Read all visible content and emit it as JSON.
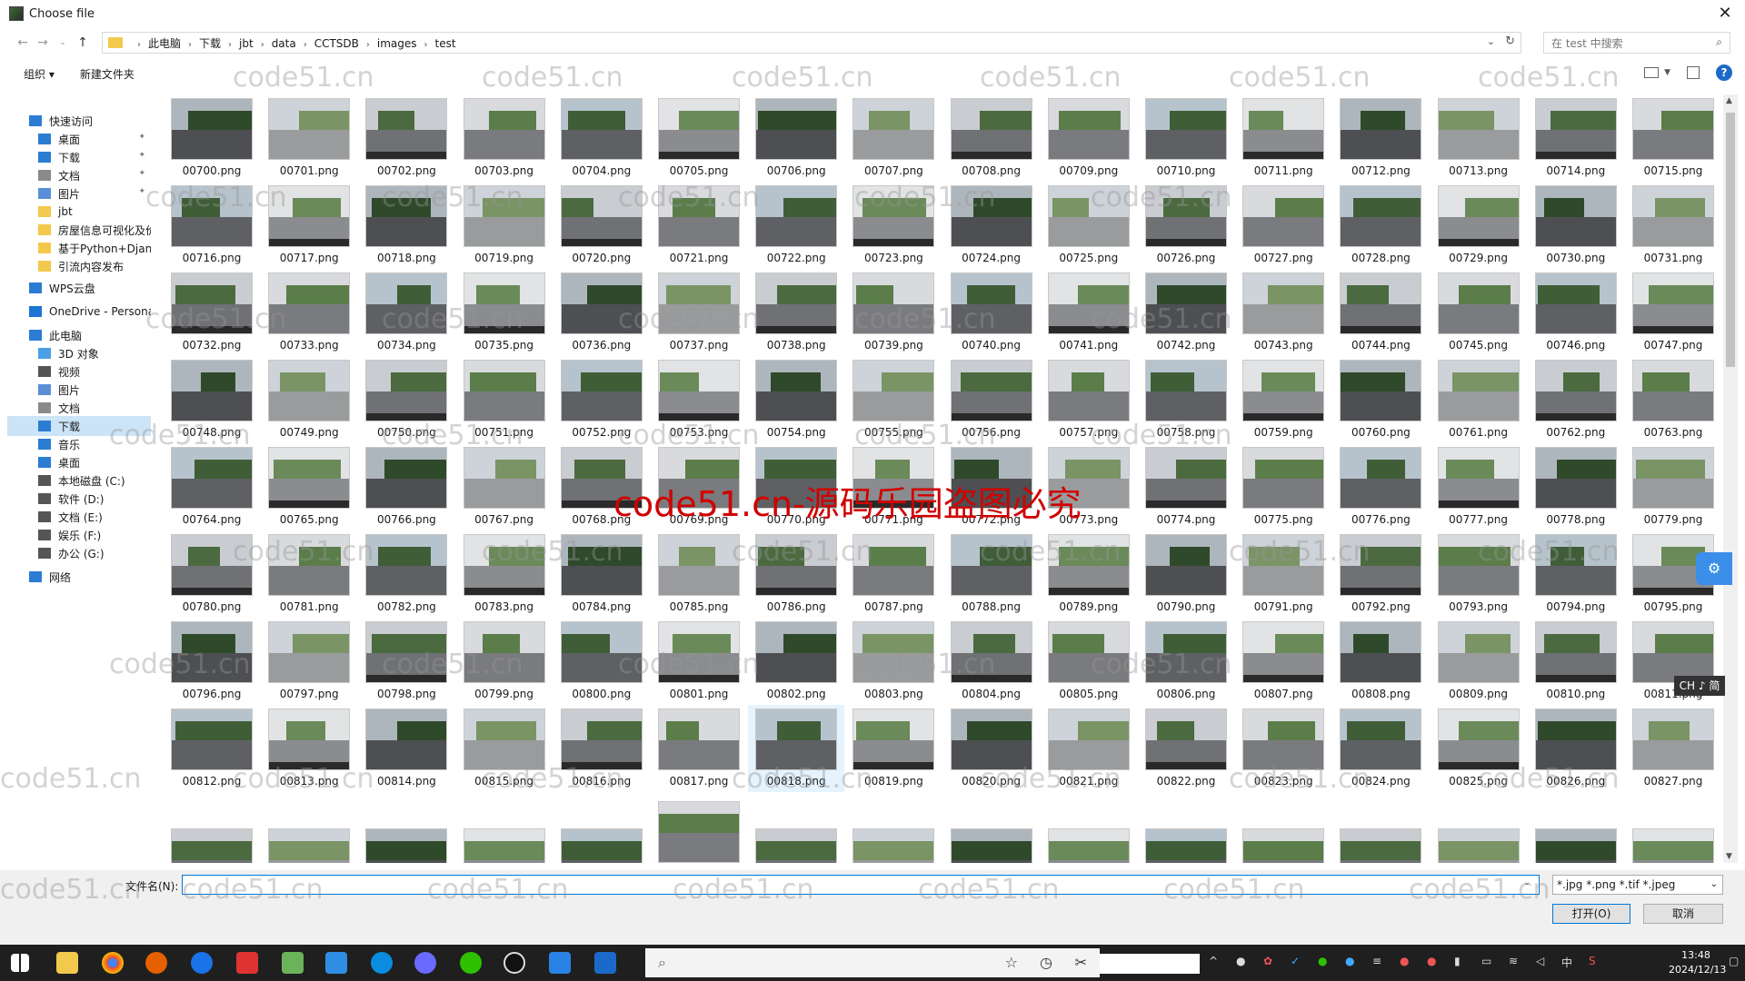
{
  "window": {
    "title": "Choose file",
    "close_glyph": "✕"
  },
  "address": {
    "crumbs": [
      "此电脑",
      "下载",
      "jbt",
      "data",
      "CCTSDB",
      "images",
      "test"
    ],
    "search_placeholder": "在 test 中搜索"
  },
  "toolbar": {
    "organize": "组织 ▾",
    "new_folder": "新建文件夹"
  },
  "nav": {
    "items": [
      {
        "label": "快速访问",
        "icon": "star-icon",
        "color": "#2b7cd3",
        "indent": 0,
        "pinned": false
      },
      {
        "label": "桌面",
        "icon": "desktop-icon",
        "color": "#2b7cd3",
        "indent": 1,
        "pinned": true
      },
      {
        "label": "下载",
        "icon": "download-icon",
        "color": "#2b7cd3",
        "indent": 1,
        "pinned": true
      },
      {
        "label": "文档",
        "icon": "document-icon",
        "color": "#8a8a8a",
        "indent": 1,
        "pinned": true
      },
      {
        "label": "图片",
        "icon": "pictures-icon",
        "color": "#5a8fd6",
        "indent": 1,
        "pinned": true
      },
      {
        "label": "jbt",
        "icon": "folder-icon",
        "color": "#f2c94c",
        "indent": 1,
        "pinned": false
      },
      {
        "label": "房屋信息可视化及价",
        "icon": "folder-icon",
        "color": "#f2c94c",
        "indent": 1,
        "pinned": false
      },
      {
        "label": "基于Python+Djang",
        "icon": "folder-icon",
        "color": "#f2c94c",
        "indent": 1,
        "pinned": false
      },
      {
        "label": "引流内容发布",
        "icon": "folder-icon",
        "color": "#f2c94c",
        "indent": 1,
        "pinned": false
      },
      {
        "label": "WPS云盘",
        "icon": "cloud-icon",
        "color": "#2b7cd3",
        "indent": 0,
        "pinned": false
      },
      {
        "label": "OneDrive - Persona",
        "icon": "onedrive-icon",
        "color": "#1c74d4",
        "indent": 0,
        "pinned": false
      },
      {
        "label": "此电脑",
        "icon": "computer-icon",
        "color": "#2b7cd3",
        "indent": 0,
        "pinned": false
      },
      {
        "label": "3D 对象",
        "icon": "3d-objects-icon",
        "color": "#4aa0e6",
        "indent": 1,
        "pinned": false
      },
      {
        "label": "视频",
        "icon": "video-icon",
        "color": "#555",
        "indent": 1,
        "pinned": false
      },
      {
        "label": "图片",
        "icon": "pictures-icon",
        "color": "#5a8fd6",
        "indent": 1,
        "pinned": false
      },
      {
        "label": "文档",
        "icon": "document-icon",
        "color": "#8a8a8a",
        "indent": 1,
        "pinned": false
      },
      {
        "label": "下载",
        "icon": "download-icon",
        "color": "#2b7cd3",
        "indent": 1,
        "pinned": false,
        "selected": true
      },
      {
        "label": "音乐",
        "icon": "music-icon",
        "color": "#2b7cd3",
        "indent": 1,
        "pinned": false
      },
      {
        "label": "桌面",
        "icon": "desktop-icon",
        "color": "#2b7cd3",
        "indent": 1,
        "pinned": false
      },
      {
        "label": "本地磁盘 (C:)",
        "icon": "drive-icon",
        "color": "#555",
        "indent": 1,
        "pinned": false
      },
      {
        "label": "软件 (D:)",
        "icon": "drive-icon",
        "color": "#555",
        "indent": 1,
        "pinned": false
      },
      {
        "label": "文档 (E:)",
        "icon": "drive-icon",
        "color": "#555",
        "indent": 1,
        "pinned": false
      },
      {
        "label": "娱乐 (F:)",
        "icon": "drive-icon",
        "color": "#555",
        "indent": 1,
        "pinned": false
      },
      {
        "label": "办公 (G:)",
        "icon": "drive-icon",
        "color": "#555",
        "indent": 1,
        "pinned": false
      },
      {
        "label": "网络",
        "icon": "network-icon",
        "color": "#2b7cd3",
        "indent": 0,
        "pinned": false
      }
    ]
  },
  "files": {
    "first_index": 700,
    "last_index": 827,
    "extension": ".png",
    "selected_file": "00818.png",
    "partial_row_visible": true
  },
  "bottom": {
    "filename_label": "文件名(N):",
    "filename_value": "",
    "filter": "*.jpg *.png *.tif *.jpeg",
    "open_button": "打开(O)",
    "cancel_button": "取消"
  },
  "overlays": {
    "watermark_text": "code51.cn",
    "big_watermark": "code51.cn-源码乐园盗图必究",
    "ime_indicator": "CH ♪ 简"
  },
  "taskbar": {
    "time": "13:48",
    "date": "2024/12/13"
  }
}
